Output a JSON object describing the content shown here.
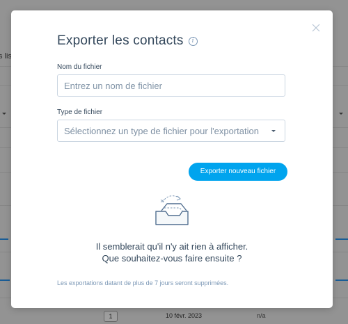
{
  "background": {
    "partial_text": "s lis",
    "row": {
      "badge": "1",
      "date": "10 févr. 2023",
      "status": "n/a"
    }
  },
  "modal": {
    "title": "Exporter les contacts",
    "info_glyph": "i",
    "file_name": {
      "label": "Nom du fichier",
      "placeholder": "Entrez un nom de fichier",
      "value": ""
    },
    "file_type": {
      "label": "Type de fichier",
      "placeholder": "Sélectionnez un type de fichier pour l'exportation"
    },
    "export_button": "Exporter nouveau fichier",
    "empty_state": {
      "line1": "Il semblerait qu'il n'y ait rien à afficher.",
      "line2": "Que souhaitez-vous faire ensuite ?"
    },
    "footer_note": "Les exportations datant de plus de 7 jours seront supprimées."
  },
  "colors": {
    "accent": "#00a4ee",
    "text": "#33475b",
    "muted": "#7c98b6",
    "border": "#cbd6e2"
  },
  "icons": {
    "close": "close-icon",
    "info": "info-icon",
    "caret": "chevron-down-icon",
    "empty": "empty-tray-icon"
  }
}
